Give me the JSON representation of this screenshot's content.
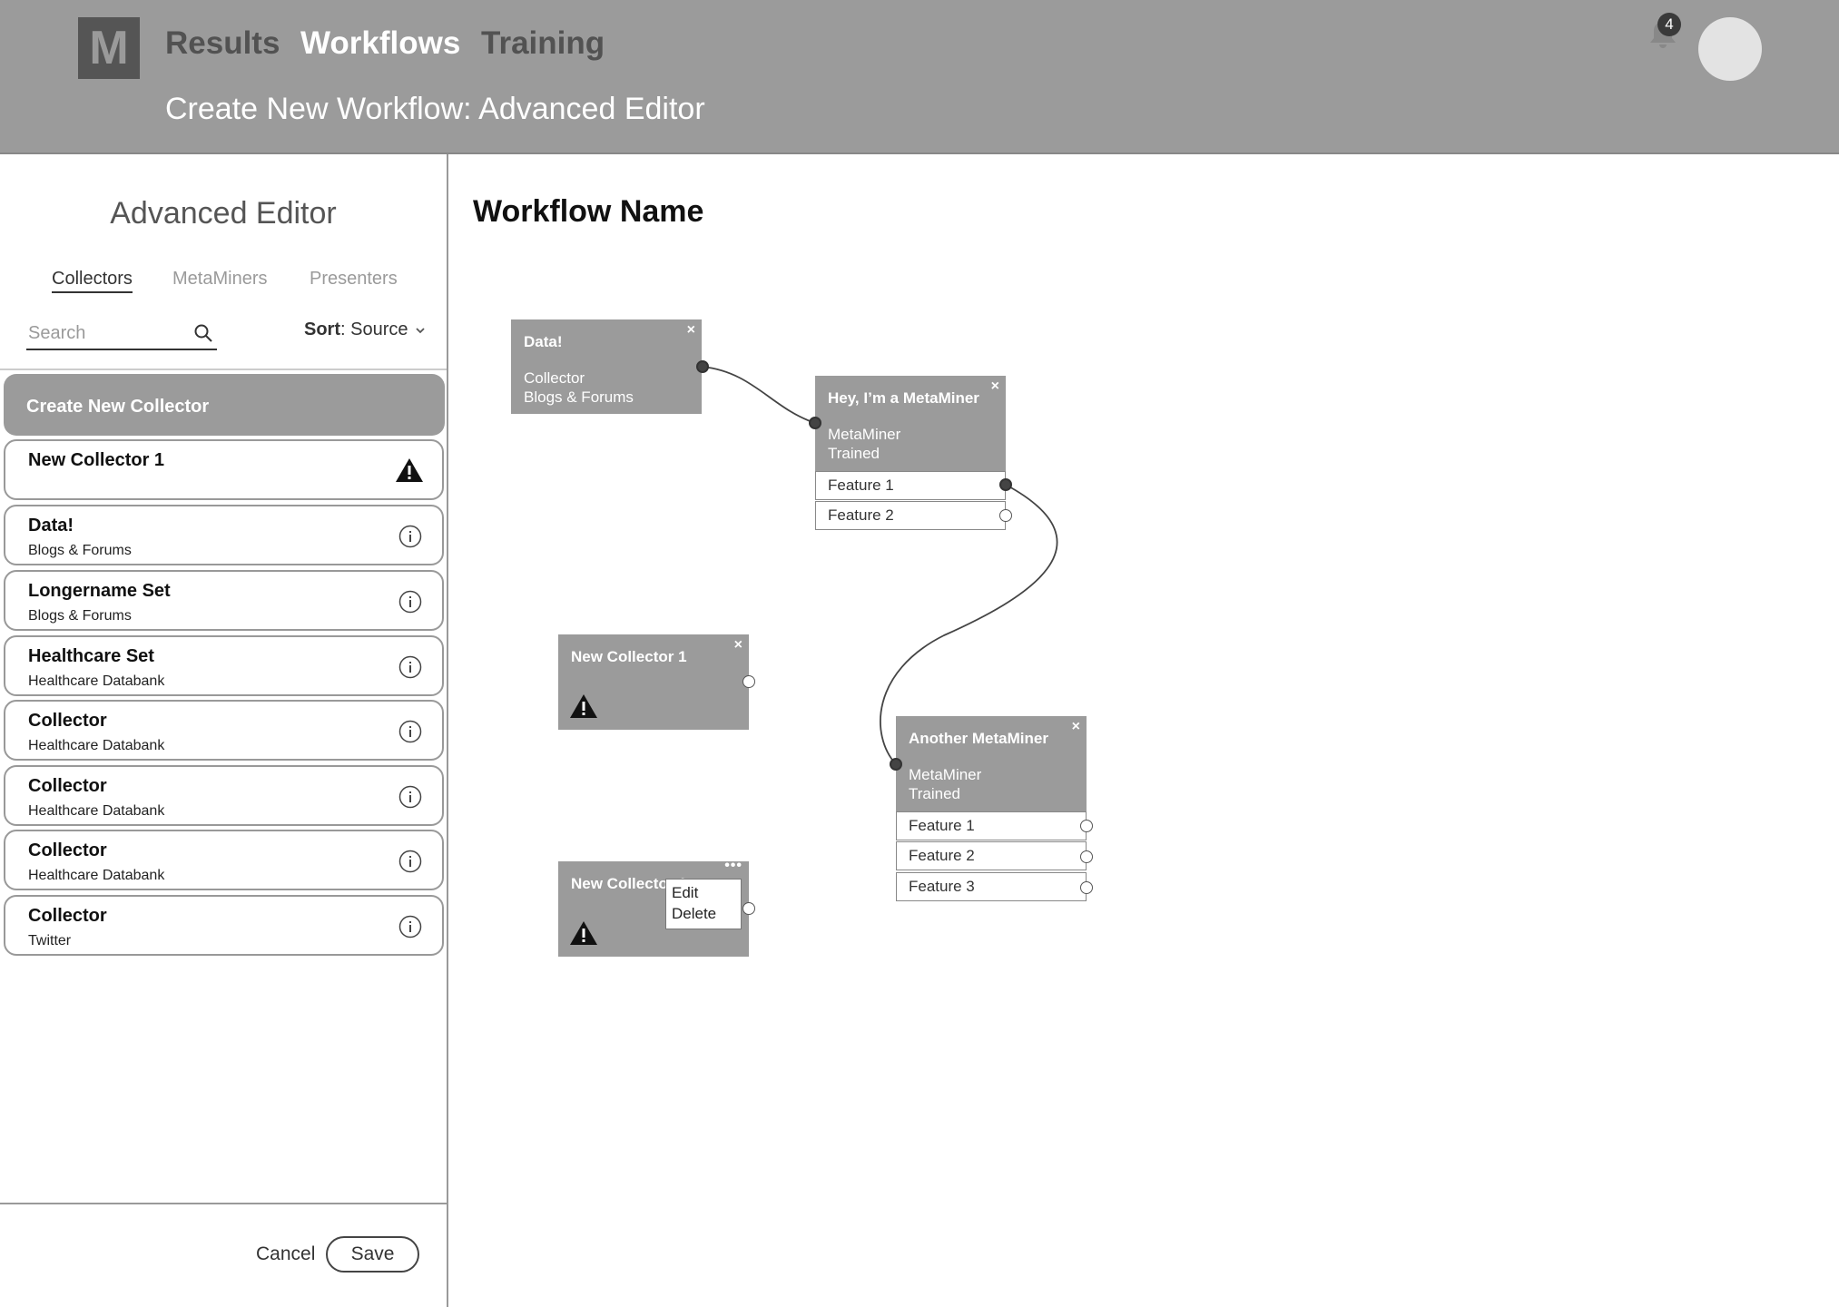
{
  "header": {
    "logo": "M",
    "nav": [
      "Results",
      "Workflows",
      "Training"
    ],
    "subtitle": "Create New Workflow: Advanced Editor",
    "notification_count": "4",
    "notification_icon": "bell-icon"
  },
  "sidebar": {
    "title": "Advanced Editor",
    "tabs": [
      "Collectors",
      "MetaMiners",
      "Presenters"
    ],
    "search_placeholder": "Search",
    "sort_label": "Sort",
    "sort_value": "Source",
    "create_label": "Create New Collector",
    "items": [
      {
        "title": "New Collector 1",
        "subtitle": "",
        "icon": "warning-icon"
      },
      {
        "title": "Data!",
        "subtitle": "Blogs & Forums",
        "icon": "info-icon"
      },
      {
        "title": "Longername Set",
        "subtitle": "Blogs & Forums",
        "icon": "info-icon"
      },
      {
        "title": "Healthcare Set",
        "subtitle": "Healthcare Databank",
        "icon": "info-icon"
      },
      {
        "title": "Collector",
        "subtitle": "Healthcare Databank",
        "icon": "info-icon"
      },
      {
        "title": "Collector",
        "subtitle": "Healthcare Databank",
        "icon": "info-icon"
      },
      {
        "title": "Collector",
        "subtitle": "Healthcare Databank",
        "icon": "info-icon"
      },
      {
        "title": "Collector",
        "subtitle": "Twitter",
        "icon": "info-icon"
      }
    ],
    "cancel_label": "Cancel",
    "save_label": "Save"
  },
  "canvas": {
    "title": "Workflow Name",
    "nodes": [
      {
        "title": "Data!",
        "line1": "Collector",
        "line2": "Blogs & Forums"
      },
      {
        "title": "Hey, I’m a MetaMiner",
        "line1": "MetaMiner",
        "line2": "Trained",
        "features": [
          "Feature 1",
          "Feature 2"
        ]
      },
      {
        "title": "New Collector 1"
      },
      {
        "title": "New Collector 1"
      },
      {
        "title": "Another MetaMiner",
        "line1": "MetaMiner",
        "line2": "Trained",
        "features": [
          "Feature 1",
          "Feature 2",
          "Feature 3"
        ]
      }
    ],
    "context_menu": [
      "Edit",
      "Delete"
    ],
    "close_glyph": "×",
    "more_glyph": "•••"
  },
  "colors": {
    "header_bg": "#9b9b9b",
    "node_bg": "#9b9b9b",
    "active_nav": "#ffffff",
    "inactive_nav": "#525252"
  }
}
